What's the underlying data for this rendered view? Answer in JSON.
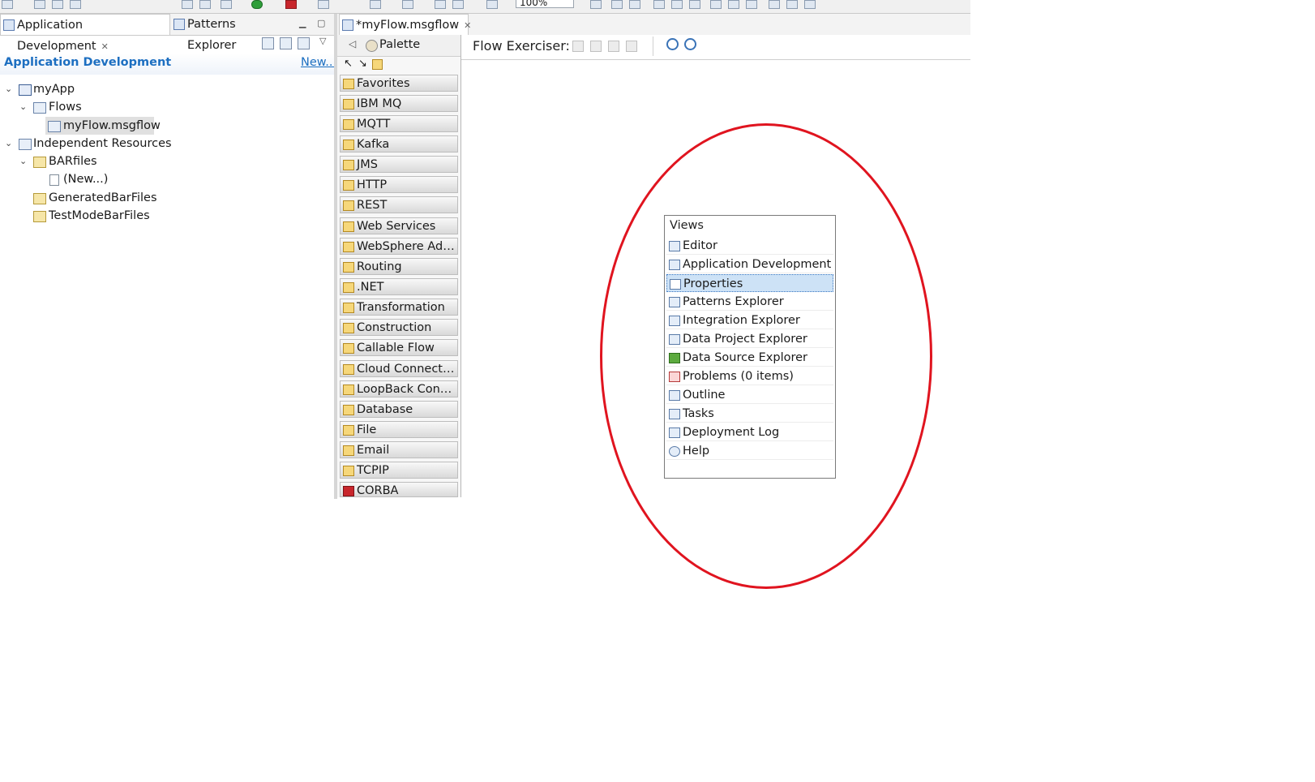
{
  "toolbar": {
    "zoom": "100%"
  },
  "left_panel": {
    "tabs": [
      {
        "label": "Application Development",
        "active": true
      },
      {
        "label": "Patterns Explorer",
        "active": false
      }
    ],
    "header_title": "Application Development",
    "new_link": "New...",
    "tree": [
      {
        "label": "myApp",
        "level": 0,
        "expanded": true,
        "icon": "application-icon"
      },
      {
        "label": "Flows",
        "level": 1,
        "expanded": true,
        "icon": "flows-folder-icon"
      },
      {
        "label": "myFlow.msgflow",
        "level": 2,
        "selected": true,
        "icon": "msgflow-file-icon"
      },
      {
        "label": "Independent Resources",
        "level": 0,
        "expanded": true,
        "icon": "resources-icon"
      },
      {
        "label": "BARfiles",
        "level": 1,
        "expanded": true,
        "icon": "folder-icon"
      },
      {
        "label": "(New...)",
        "level": 2,
        "icon": "new-file-icon"
      },
      {
        "label": "GeneratedBarFiles",
        "level": 1,
        "icon": "folder-icon"
      },
      {
        "label": "TestModeBarFiles",
        "level": 1,
        "icon": "folder-icon"
      }
    ]
  },
  "editor": {
    "tab_label": "*myFlow.msgflow",
    "flow_exerciser_label": "Flow Exerciser:"
  },
  "palette": {
    "title": "Palette",
    "drawers": [
      "Favorites",
      "IBM MQ",
      "MQTT",
      "Kafka",
      "JMS",
      "HTTP",
      "REST",
      "Web Services",
      "WebSphere Adap...",
      "Routing",
      ".NET",
      "Transformation",
      "Construction",
      "Callable Flow",
      "Cloud Connectors",
      "LoopBack Conne...",
      "Database",
      "File",
      "Email",
      "TCPIP",
      "CORBA"
    ]
  },
  "views_popup": {
    "title": "Views",
    "items": [
      {
        "label": "Editor",
        "icon": "editor-icon"
      },
      {
        "label": "Application Development",
        "icon": "application-development-icon"
      },
      {
        "label": "Properties",
        "icon": "properties-icon",
        "highlighted": true
      },
      {
        "label": "Patterns Explorer",
        "icon": "patterns-explorer-icon"
      },
      {
        "label": "Integration Explorer",
        "icon": "integration-explorer-icon"
      },
      {
        "label": "Data Project Explorer",
        "icon": "data-project-explorer-icon"
      },
      {
        "label": "Data Source Explorer",
        "icon": "data-source-explorer-icon"
      },
      {
        "label": "Problems (0 items)",
        "icon": "problems-icon"
      },
      {
        "label": "Outline",
        "icon": "outline-icon"
      },
      {
        "label": "Tasks",
        "icon": "tasks-icon"
      },
      {
        "label": "Deployment Log",
        "icon": "deployment-log-icon"
      },
      {
        "label": "Help",
        "icon": "help-icon"
      }
    ]
  },
  "colors": {
    "link_blue": "#1d6fc1",
    "annotation_red": "#e0141f",
    "highlight": "#cde2f6"
  }
}
